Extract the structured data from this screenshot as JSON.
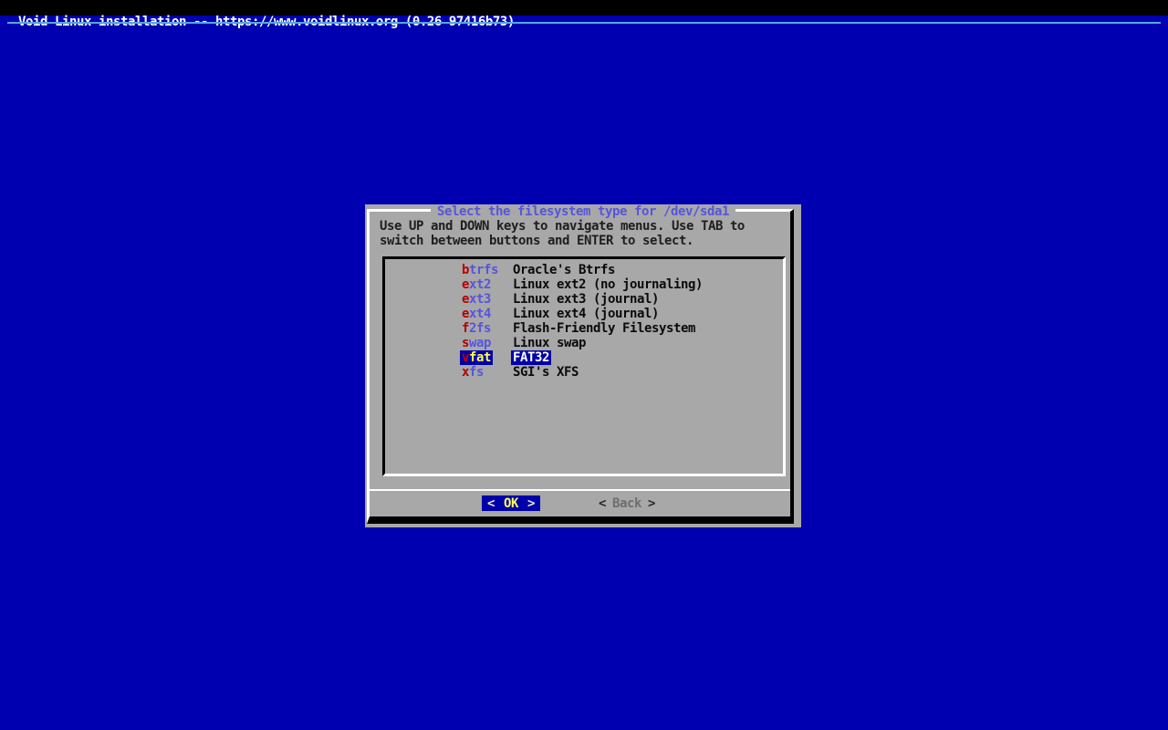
{
  "screen": {
    "backtitle": "Void Linux installation -- https://www.voidlinux.org (0.26 97416b73)",
    "colors": {
      "screen_bg": "#0000b0",
      "topbar_bg": "#000000",
      "topbar_fg": "#ffffff",
      "backtitle_separator": "#55a8dc",
      "dialog_bg": "#a8a8a8",
      "selection_bg": "#0000a8",
      "title_fg": "#5555dd",
      "tag_key_fg": "#b40000",
      "tag_fg": "#5555dd",
      "selected_tag_fg": "#ffff55",
      "selected_desc_fg": "#ffffff",
      "button_label_active_fg": "#ffff55",
      "button_label_inactive_fg": "#6e6e6e"
    }
  },
  "dialog": {
    "title": "Select the filesystem type for /dev/sda1",
    "instructions": [
      "Use UP and DOWN keys to navigate menus. Use TAB to",
      "switch between buttons and ENTER to select."
    ],
    "menu": {
      "selected_index": 6,
      "items": [
        {
          "key": "b",
          "rest": "trfs",
          "tag": "btrfs",
          "description": "Oracle's Btrfs"
        },
        {
          "key": "e",
          "rest": "xt2",
          "tag": "ext2",
          "description": "Linux ext2 (no journaling)"
        },
        {
          "key": "e",
          "rest": "xt3",
          "tag": "ext3",
          "description": "Linux ext3 (journal)"
        },
        {
          "key": "e",
          "rest": "xt4",
          "tag": "ext4",
          "description": "Linux ext4 (journal)"
        },
        {
          "key": "f",
          "rest": "2fs",
          "tag": "f2fs",
          "description": "Flash-Friendly Filesystem"
        },
        {
          "key": "s",
          "rest": "wap",
          "tag": "swap",
          "description": "Linux swap"
        },
        {
          "key": "v",
          "rest": "fat",
          "tag": "vfat",
          "description": "FAT32"
        },
        {
          "key": "x",
          "rest": "fs",
          "tag": "xfs",
          "description": "SGI's XFS"
        }
      ]
    },
    "buttons": [
      {
        "label": "OK",
        "selected": true
      },
      {
        "label": "Back",
        "selected": false
      }
    ],
    "bracket_left": "<",
    "bracket_right": ">"
  }
}
